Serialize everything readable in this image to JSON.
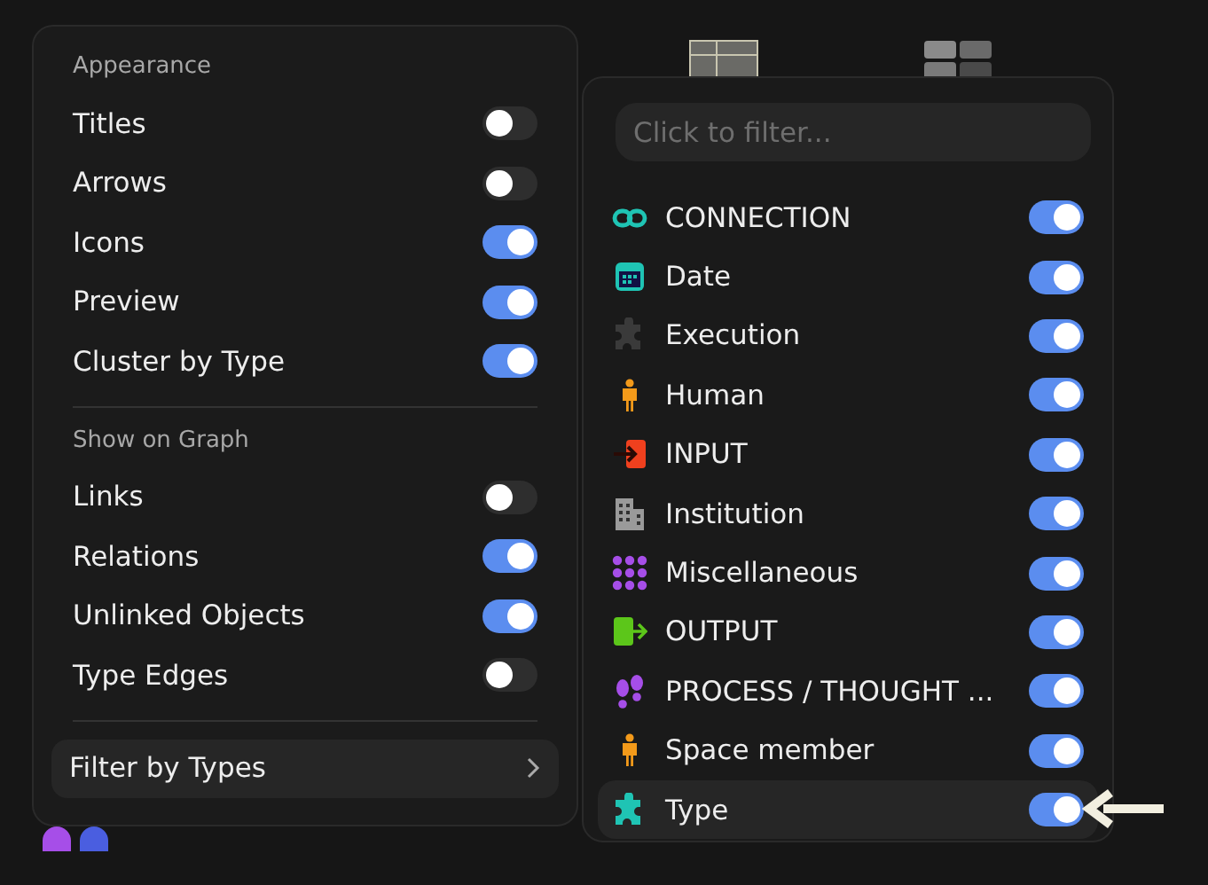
{
  "appearance": {
    "title": "Appearance",
    "items": [
      {
        "label": "Titles",
        "on": false
      },
      {
        "label": "Arrows",
        "on": false
      },
      {
        "label": "Icons",
        "on": true
      },
      {
        "label": "Preview",
        "on": true
      },
      {
        "label": "Cluster by Type",
        "on": true
      }
    ]
  },
  "show_on_graph": {
    "title": "Show on Graph",
    "items": [
      {
        "label": "Links",
        "on": false
      },
      {
        "label": "Relations",
        "on": true
      },
      {
        "label": "Unlinked Objects",
        "on": true
      },
      {
        "label": "Type Edges",
        "on": false
      }
    ]
  },
  "filter_button": {
    "label": "Filter by Types"
  },
  "type_filter": {
    "search": {
      "placeholder": "Click to filter..."
    },
    "types": [
      {
        "label": "CONNECTION",
        "kind": "link",
        "color": "#1fc4b4",
        "on": true,
        "selected": false
      },
      {
        "label": "Date",
        "kind": "calendar",
        "color": "#1fc4b4",
        "on": true,
        "selected": false
      },
      {
        "label": "Execution",
        "kind": "puzzle",
        "color": "#3a3a3a",
        "on": true,
        "selected": false
      },
      {
        "label": "Human",
        "kind": "person",
        "color": "#f39a1a",
        "on": true,
        "selected": false
      },
      {
        "label": "INPUT",
        "kind": "input",
        "color": "#f0401e",
        "on": true,
        "selected": false
      },
      {
        "label": "Institution",
        "kind": "building",
        "color": "#9a9a9a",
        "on": true,
        "selected": false
      },
      {
        "label": "Miscellaneous",
        "kind": "grid",
        "color": "#a64ee8",
        "on": true,
        "selected": false
      },
      {
        "label": "OUTPUT",
        "kind": "output",
        "color": "#5cc61a",
        "on": true,
        "selected": false
      },
      {
        "label": "PROCESS / THOUGHT ...",
        "kind": "footprints",
        "color": "#a64ee8",
        "on": true,
        "selected": false
      },
      {
        "label": "Space member",
        "kind": "person",
        "color": "#f39a1a",
        "on": true,
        "selected": false
      },
      {
        "label": "Type",
        "kind": "puzzle",
        "color": "#1fc4b4",
        "on": true,
        "selected": true
      }
    ]
  }
}
